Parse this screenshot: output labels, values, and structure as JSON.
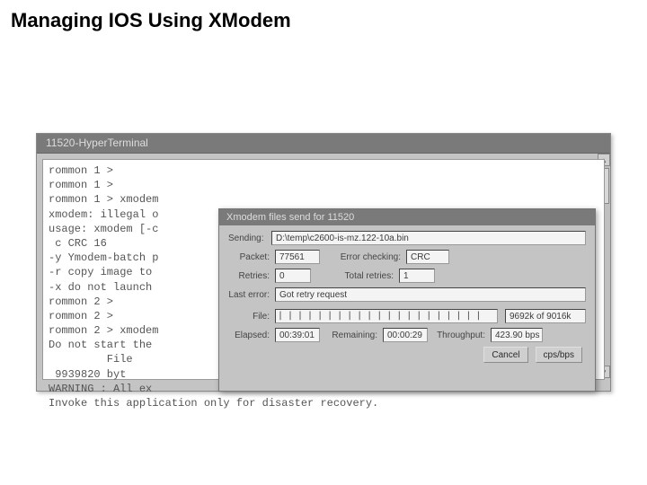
{
  "page": {
    "title": "Managing IOS Using XModem"
  },
  "window": {
    "title": "11520-HyperTerminal"
  },
  "terminal": {
    "text": "rommon 1 >\nrommon 1 >\nrommon 1 > xmodem\nxmodem: illegal o\nusage: xmodem [-c\n c CRC 16\n-y Ymodem-batch p\n-r copy image to\n-x do not launch\nrommon 2 >\nrommon 2 >\nrommon 2 > xmodem\nDo not start the\n         File\n 9939820 byt\nWARNING : All ex\nInvoke this application only for disaster recovery."
  },
  "dialog": {
    "title": "Xmodem files send for 11520",
    "labels": {
      "sending": "Sending:",
      "packet": "Packet:",
      "error_checking": "Error checking:",
      "retries": "Retries:",
      "total_retries": "Total retries:",
      "last_error": "Last error:",
      "file": "File:",
      "elapsed": "Elapsed:",
      "remaining": "Remaining:",
      "throughput": "Throughput:"
    },
    "values": {
      "sending": "D:\\temp\\c2600-is-mz.122-10a.bin",
      "packet": "77561",
      "error_checking": "CRC",
      "retries": "0",
      "total_retries": "1",
      "last_error": "Got retry request",
      "file_status": "9692k of 9016k",
      "elapsed": "00:39:01",
      "remaining": "00:00:29",
      "throughput": "423.90 bps"
    },
    "buttons": {
      "cancel": "Cancel",
      "cpsbps": "cps/bps"
    }
  }
}
